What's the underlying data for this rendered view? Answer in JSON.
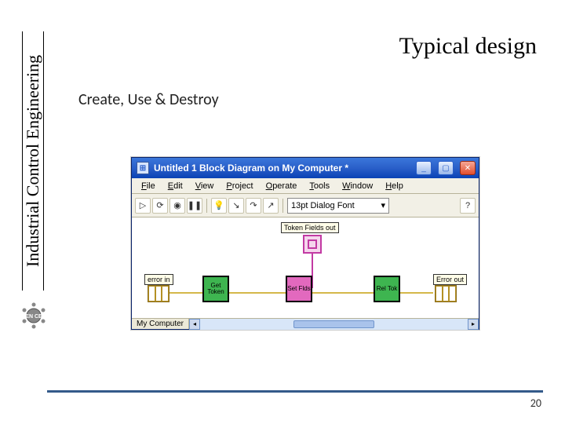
{
  "slide": {
    "side_label": "Industrial Control Engineering",
    "title": "Typical design",
    "subtitle": "Create, Use & Destroy",
    "page_number": "20",
    "logo_text": "EN CE"
  },
  "window": {
    "title": "Untitled 1 Block Diagram on My Computer *",
    "buttons": {
      "minimize": "_",
      "maximize": "▢",
      "close": "✕"
    },
    "menu": {
      "file": "File",
      "edit": "Edit",
      "view": "View",
      "project": "Project",
      "operate": "Operate",
      "tools": "Tools",
      "window": "Window",
      "help": "Help"
    },
    "toolbar": {
      "run": "▷",
      "run_cont": "⟳",
      "abort": "◉",
      "pause": "❚❚",
      "lightbulb": "💡",
      "step_into": "↘",
      "step_over": "↷",
      "step_out": "↗",
      "font_selector": "13pt Dialog Font",
      "help": "?"
    },
    "diagram": {
      "token_fields_out": "Token Fields out",
      "error_in": "error in",
      "error_out": "Error out",
      "get_token": "Get Token",
      "set_fields": "Set Flds",
      "release": "Rel Tok"
    },
    "status": {
      "context": "My Computer"
    }
  }
}
